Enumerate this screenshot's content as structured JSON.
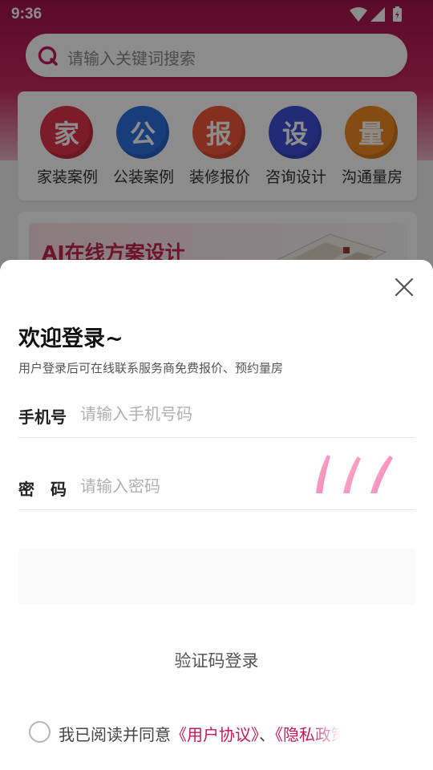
{
  "status": {
    "time": "9:36"
  },
  "search": {
    "placeholder": "请输入关键词搜索"
  },
  "categories": [
    {
      "glyph": "家",
      "label": "家装案例",
      "color": "#e0344a"
    },
    {
      "glyph": "公",
      "label": "公装案例",
      "color": "#2f6fe0"
    },
    {
      "glyph": "报",
      "label": "装修报价",
      "color": "#f0573a"
    },
    {
      "glyph": "设",
      "label": "咨询设计",
      "color": "#3f4fd6"
    },
    {
      "glyph": "量",
      "label": "沟通量房",
      "color": "#f08a1e"
    }
  ],
  "banner": {
    "title": "AI在线方案设计"
  },
  "login": {
    "title": "欢迎登录~",
    "subtitle": "用户登录后可在线联系服务商免费报价、预约量房",
    "phone_label": "手机号",
    "phone_placeholder": "请输入手机号码",
    "password_label": "密　码",
    "password_placeholder": "请输入密码",
    "code_login": "验证码登录",
    "agree_prefix": "我已阅读并同意",
    "user_agreement": "《用户协议》",
    "separator": "、",
    "privacy_policy": "《隐私政策》"
  },
  "colors": {
    "accent": "#c2185b",
    "header": "#a5134c"
  }
}
